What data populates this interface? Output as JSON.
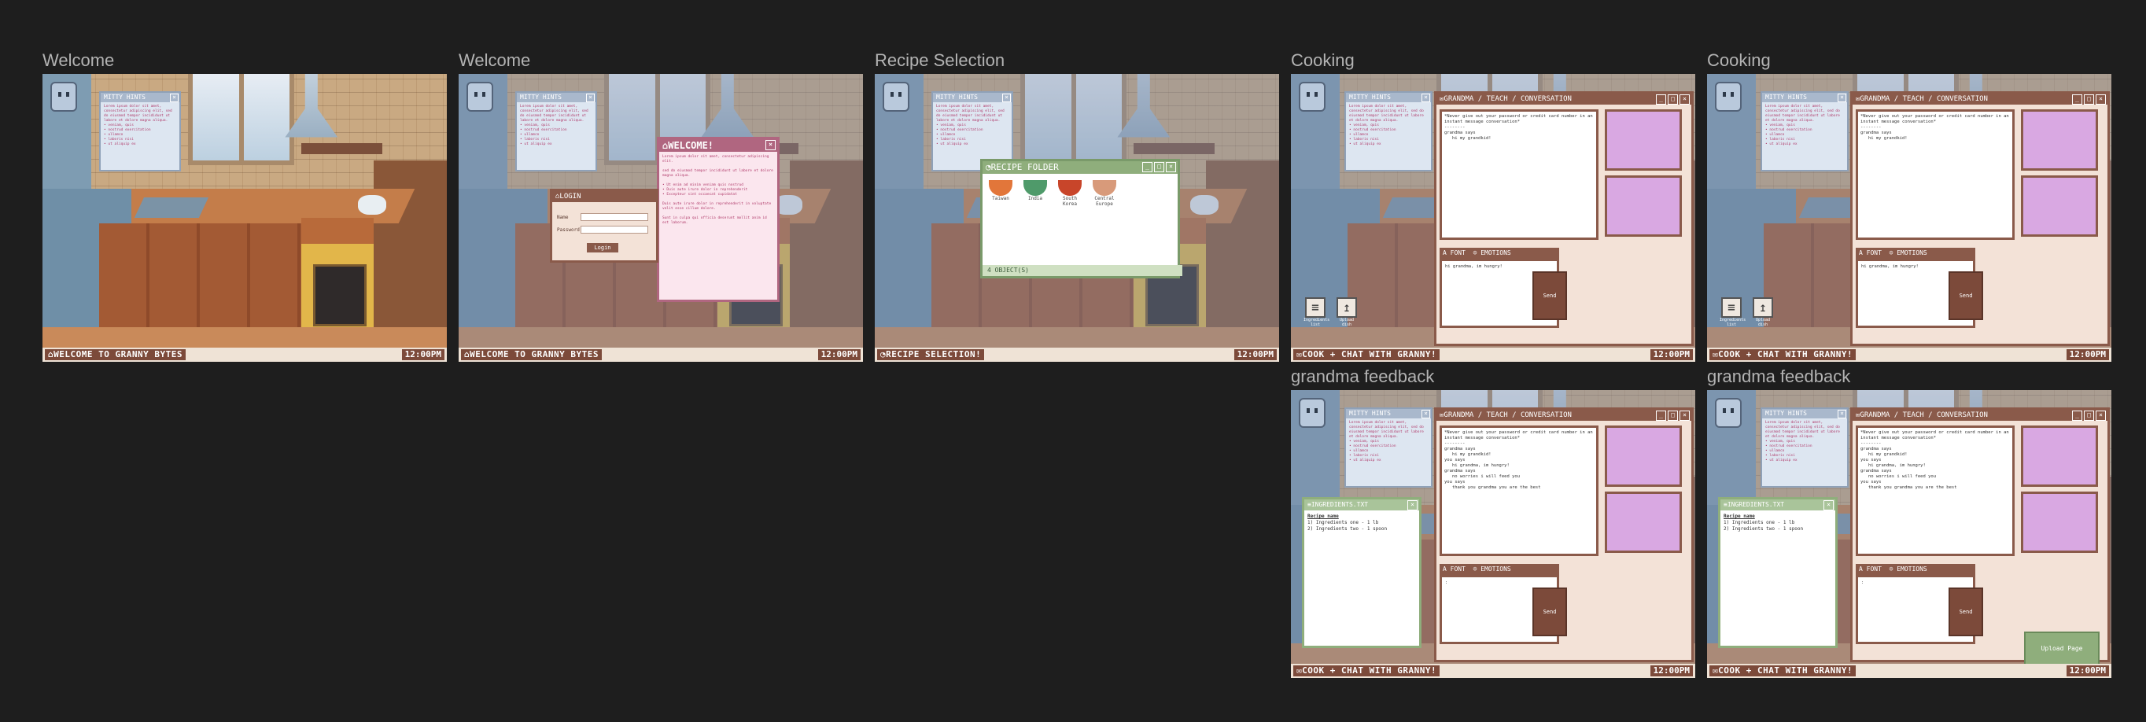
{
  "frames": [
    {
      "label": "Welcome",
      "status": "WELCOME TO GRANNY BYTES",
      "time": "12:00PM"
    },
    {
      "label": "Welcome",
      "status": "WELCOME TO GRANNY BYTES",
      "time": "12:00PM"
    },
    {
      "label": "Recipe Selection",
      "status": "RECIPE SELECTION!",
      "time": "12:00PM"
    },
    {
      "label": "Cooking",
      "status": "COOK + CHAT WITH GRANNY!",
      "time": "12:00PM"
    },
    {
      "label": "Cooking",
      "status": "COOK + CHAT WITH GRANNY!",
      "time": "12:00PM"
    },
    {
      "label": "grandma feedback",
      "status": "COOK + CHAT WITH GRANNY!",
      "time": "12:00PM"
    },
    {
      "label": "grandma feedback",
      "status": "COOK + CHAT WITH GRANNY!",
      "time": "12:00PM"
    }
  ],
  "mitty": {
    "title": "MITTY HINTS",
    "text": "Lorem ipsum dolor sit amet, consectetur adipiscing elit, sed do eiusmod tempor incididunt ut labore et dolore magna aliqua.\n• veniam, quis\n• nostrud exercitation\n• ullamco\n• laboris nisi\n• ut aliquip ex"
  },
  "welcome": {
    "title": "WELCOME!",
    "text": "Lorem ipsum dolor sit amet, consectetur adipiscing elit.\n\nsed do eiusmod tempor incididunt ut labore et dolore magna aliqua.\n\n• Ut enim ad minim veniam quis nostrud\n• Duis aute irure dolor in reprehenderit\n• Excepteur sint occaecat cupidatat\n\nDuis aute irure dolor in reprehenderit in voluptate velit esse cillum dolore.\n\nSunt in culpa qui officia deserunt mollit anim id est laborum."
  },
  "login": {
    "title": "LOGIN",
    "name_label": "Name",
    "password_label": "Password",
    "button": "Login"
  },
  "folder": {
    "title": "RECIPE FOLDER",
    "footer": "4 OBJECT(S)",
    "recipes": [
      {
        "name": "Taiwan",
        "color": "#e2763a"
      },
      {
        "name": "India",
        "color": "#4f9a6a"
      },
      {
        "name": "South Korea",
        "color": "#c8452a"
      },
      {
        "name": "Central Europe",
        "color": "#d89a7a"
      }
    ]
  },
  "chat": {
    "title": "GRANDMA / TEACH / CONVERSATION",
    "convo_short": [
      "*Never give out your password or credit card number in an instant message conversation*",
      "--------",
      "grandma says",
      "   hi my grandkid!"
    ],
    "convo_long": [
      "*Never give out your password or credit card number in an instant message conversation*",
      "--------",
      "grandma says",
      "   hi my grandkid!",
      "you says",
      "   hi grandma, im hungry!",
      "grandma says",
      "   no worries i will feed you",
      "you says",
      "   thank you grandma you are the best"
    ],
    "font_label": "FONT",
    "emotions_label": "EMOTIONS",
    "input_text": "hi grandma, im hungry!",
    "input_empty": ":",
    "send": "Send",
    "upload": "Upload Page"
  },
  "desktop": {
    "icon1": "Ingredients list",
    "icon2": "Upload dish"
  },
  "ingredients": {
    "title": "INGREDIENTS.TXT",
    "heading": "Recipe name",
    "lines": [
      "1) Ingredients one - 1 lb",
      "2) Ingredients two - 1 spoon"
    ]
  },
  "colors": {
    "accent": "#8a5a4a",
    "hint_text": "#b03a6a",
    "photo": "#d9a8e2",
    "folder_green": "#8fae7c"
  }
}
